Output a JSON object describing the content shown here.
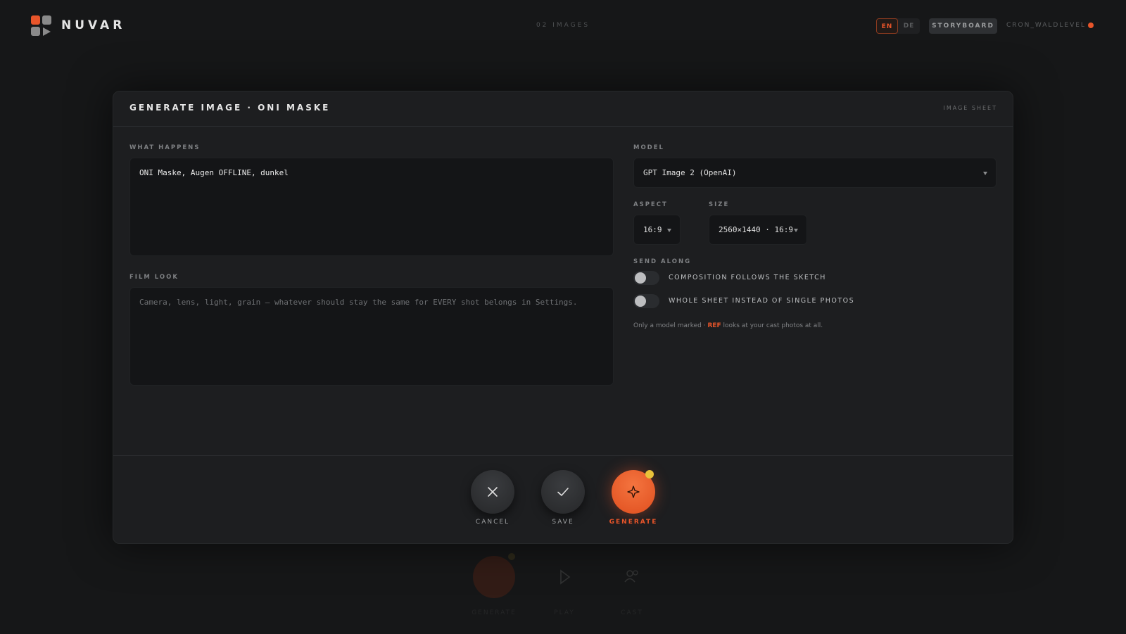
{
  "app": {
    "brand": "NUVAR",
    "image_count": "02 IMAGES",
    "languages": [
      "EN",
      "DE"
    ],
    "active_language": "EN",
    "storyboard_label": "STORYBOARD",
    "user": "CRON_WALDLEVEL"
  },
  "modal": {
    "title": "GENERATE IMAGE · ONI MASKE",
    "sheet_label": "IMAGE SHEET",
    "what_happens": {
      "label": "WHAT HAPPENS",
      "value": "ONI Maske, Augen OFFLINE, dunkel"
    },
    "film_look": {
      "label": "FILM LOOK",
      "placeholder": "Camera, lens, light, grain — whatever should stay the same for EVERY shot belongs in Settings."
    },
    "model": {
      "label": "MODEL",
      "value": "GPT Image 2 (OpenAI)"
    },
    "aspect": {
      "label": "ASPECT",
      "value": "16:9"
    },
    "size": {
      "label": "SIZE",
      "value": "2560×1440 · 16:9"
    },
    "send_along": {
      "label": "SEND ALONG",
      "options": [
        {
          "label": "COMPOSITION FOLLOWS THE SKETCH",
          "enabled": false
        },
        {
          "label": "WHOLE SHEET INSTEAD OF SINGLE PHOTOS",
          "enabled": false
        }
      ],
      "note_before": "Only a model marked · ",
      "note_ref": "REF",
      "note_after": " looks at your cast photos at all."
    },
    "footer": {
      "cancel": "CANCEL",
      "save": "SAVE",
      "generate": "GENERATE"
    }
  },
  "background_dock": {
    "generate": "GENERATE",
    "play": "PLAY",
    "cast": "CAST"
  },
  "colors": {
    "accent": "#e8552a",
    "badge": "#e9c23a",
    "background": "#161718",
    "panel": "#1d1e20"
  }
}
